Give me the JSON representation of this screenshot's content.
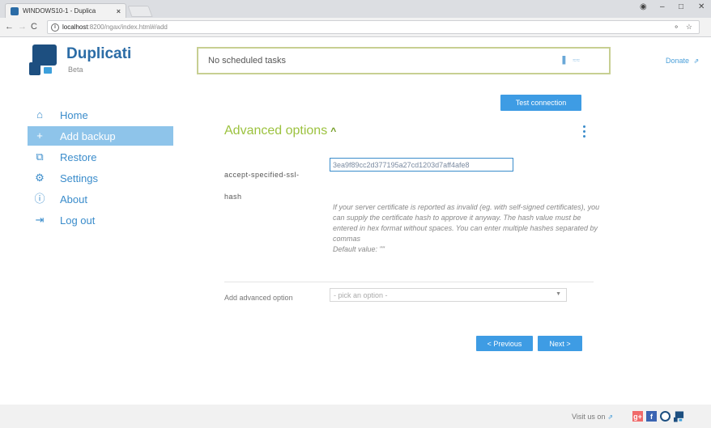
{
  "browser": {
    "tab_title": "WINDOWS10-1 - Duplica",
    "url_host": "localhost",
    "url_path": ":8200/ngax/index.html#/add",
    "min": "–",
    "max": "□",
    "close": "✕"
  },
  "header": {
    "brand": "Duplicati",
    "brand_sub": "Beta",
    "status_text": "No scheduled tasks",
    "donate": "Donate"
  },
  "sidebar": {
    "items": [
      {
        "label": "Home",
        "icon": "home-icon"
      },
      {
        "label": "Add backup",
        "icon": "plus-icon",
        "active": true
      },
      {
        "label": "Restore",
        "icon": "restore-icon"
      },
      {
        "label": "Settings",
        "icon": "gear-icon"
      },
      {
        "label": "About",
        "icon": "info-icon"
      },
      {
        "label": "Log out",
        "icon": "logout-icon"
      }
    ]
  },
  "main": {
    "test_connection": "Test connection",
    "section_title": "Advanced options",
    "option_label_line1": "accept-specified-ssl-",
    "option_label_line2": "hash",
    "hash_value": "3ea9f89cc2d377195a27cd1203d7aff4afe8",
    "help_text": "If your server certificate is reported as invalid (eg. with self-signed certificates), you can supply the certificate hash to approve it anyway. The hash value must be entered in hex format without spaces. You can enter multiple hashes separated by commas",
    "default_value": "Default value: \"\"",
    "add_option_label": "Add advanced option",
    "add_option_placeholder": "- pick an option -",
    "previous": "< Previous",
    "next": "Next >"
  },
  "footer": {
    "visit": "Visit us on"
  },
  "colors": {
    "accent": "#3e9ce4",
    "active_nav": "#8ec4ea",
    "section_title": "#9cc23f",
    "status_border": "#c7cf92"
  }
}
